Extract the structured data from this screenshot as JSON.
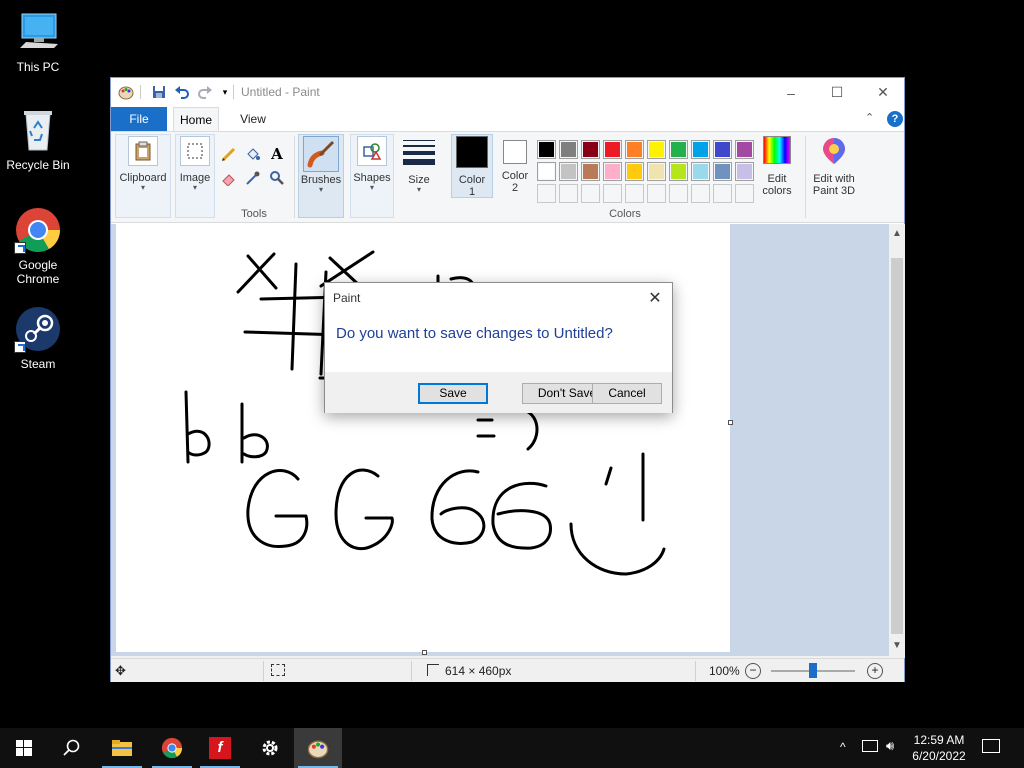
{
  "desktop": {
    "icons": [
      {
        "label": "This PC"
      },
      {
        "label": "Recycle Bin"
      },
      {
        "label": "Google Chrome"
      },
      {
        "label": "Steam"
      }
    ]
  },
  "window": {
    "title": "Untitled - Paint",
    "controls": {
      "minimize": "–",
      "maximize": "☐",
      "close": "✕"
    }
  },
  "ribbon": {
    "tabs": {
      "file": "File",
      "home": "Home",
      "view": "View"
    },
    "clipboard": "Clipboard",
    "image": "Image",
    "tools": "Tools",
    "brushes": "Brushes",
    "shapes": "Shapes",
    "size": "Size",
    "color1": {
      "label": "Color",
      "num": "1"
    },
    "color2": {
      "label": "Color",
      "num": "2"
    },
    "colors": "Colors",
    "edit_colors": {
      "line1": "Edit",
      "line2": "colors"
    },
    "paint3d": {
      "line1": "Edit with",
      "line2": "Paint 3D"
    },
    "palette_row1": [
      "#000000",
      "#7f7f7f",
      "#880015",
      "#ed1c24",
      "#ff7f27",
      "#fff200",
      "#22b14c",
      "#00a2e8",
      "#3f48cc",
      "#a349a4"
    ],
    "palette_row2": [
      "#ffffff",
      "#c3c3c3",
      "#b97a57",
      "#ffaec9",
      "#ffc90e",
      "#efe4b0",
      "#b5e61d",
      "#99d9ea",
      "#7092be",
      "#c8bfe7"
    ]
  },
  "status": {
    "canvas_size": "614 × 460px",
    "zoom": "100%"
  },
  "dialog": {
    "title": "Paint",
    "message": "Do you want to save changes to Untitled?",
    "save": "Save",
    "dont_save": "Don't Save",
    "cancel": "Cancel"
  },
  "taskbar": {
    "time": "12:59 AM",
    "date": "6/20/2022"
  }
}
